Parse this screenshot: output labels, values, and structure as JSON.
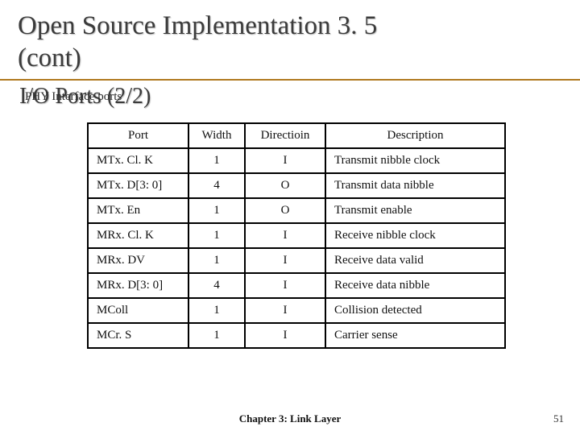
{
  "title_line1": "Open Source Implementation 3. 5",
  "title_line2": "(cont)",
  "io_ports_label": "I/O Ports (2/2)",
  "phy_label": "PHY Interface ports",
  "table": {
    "headers": {
      "port": "Port",
      "width": "Width",
      "direction": "Directioin",
      "description": "Description"
    },
    "rows": [
      {
        "port": "MTx. Cl. K",
        "width": "1",
        "dir": "I",
        "desc": "Transmit nibble clock"
      },
      {
        "port": "MTx. D[3: 0]",
        "width": "4",
        "dir": "O",
        "desc": "Transmit data nibble"
      },
      {
        "port": "MTx. En",
        "width": "1",
        "dir": "O",
        "desc": "Transmit enable"
      },
      {
        "port": "MRx. Cl. K",
        "width": "1",
        "dir": "I",
        "desc": "Receive nibble clock"
      },
      {
        "port": "MRx. DV",
        "width": "1",
        "dir": "I",
        "desc": "Receive data valid"
      },
      {
        "port": "MRx. D[3: 0]",
        "width": "4",
        "dir": "I",
        "desc": "Receive data nibble"
      },
      {
        "port": "MColl",
        "width": "1",
        "dir": "I",
        "desc": "Collision detected"
      },
      {
        "port": "MCr. S",
        "width": "1",
        "dir": "I",
        "desc": "Carrier sense"
      }
    ]
  },
  "footer": "Chapter 3: Link Layer",
  "page_number": "51"
}
